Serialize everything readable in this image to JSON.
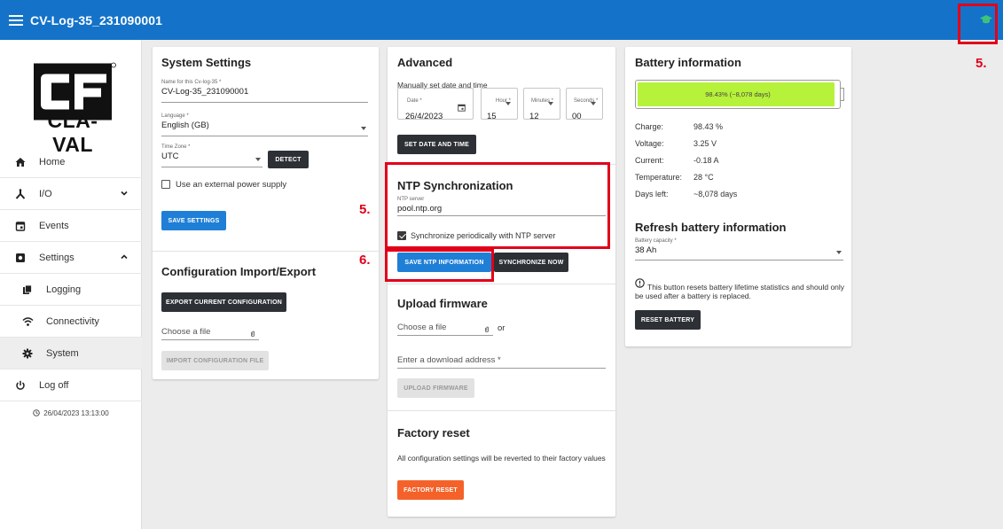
{
  "header": {
    "title": "CV-Log-35_231090001"
  },
  "sidebar": {
    "logo_text": "CLA-VAL",
    "items": [
      {
        "label": "Home",
        "icon": "home-icon"
      },
      {
        "label": "I/O",
        "icon": "io-icon"
      },
      {
        "label": "Events",
        "icon": "events-icon"
      },
      {
        "label": "Settings",
        "icon": "settings-icon"
      },
      {
        "label": "Logging",
        "icon": "logging-icon"
      },
      {
        "label": "Connectivity",
        "icon": "wifi-icon"
      },
      {
        "label": "System",
        "icon": "gear-icon"
      },
      {
        "label": "Log off",
        "icon": "power-icon"
      }
    ],
    "clock": "26/04/2023 13:13:00"
  },
  "system_settings": {
    "title": "System Settings",
    "name_label": "Name for this Cv-log-35 *",
    "name_value": "CV-Log-35_231090001",
    "language_label": "Language *",
    "language_value": "English (GB)",
    "timezone_label": "Time Zone *",
    "timezone_value": "UTC",
    "detect_label": "DETECT",
    "external_power_label": "Use an external power supply",
    "save_label": "SAVE SETTINGS",
    "config_title": "Configuration Import/Export",
    "export_label": "EXPORT CURRENT CONFIGURATION",
    "choose_file": "Choose a file",
    "import_label": "IMPORT CONFIGURATION FILE"
  },
  "advanced": {
    "title": "Advanced",
    "manual_label": "Manually set date and time",
    "date_label": "Date *",
    "date_value": "26/4/2023",
    "hour_label": "Hour *",
    "hour_value": "15",
    "minutes_label": "Minutes *",
    "minutes_value": "12",
    "seconds_label": "Seconds *",
    "seconds_value": "00",
    "set_label": "SET DATE AND TIME",
    "ntp_title": "NTP Synchronization",
    "ntp_server_label": "NTP server",
    "ntp_server_value": "pool.ntp.org",
    "sync_periodic_label": "Synchronize periodically with NTP server",
    "save_ntp_label": "SAVE NTP INFORMATION",
    "sync_now_label": "SYNCHRONIZE NOW",
    "upload_title": "Upload firmware",
    "choose_file": "Choose a file",
    "or_text": "or",
    "download_placeholder": "Enter a download address *",
    "upload_label": "UPLOAD FIRMWARE",
    "factory_title": "Factory reset",
    "factory_desc": "All configuration settings will be reverted to their factory values",
    "factory_label": "FACTORY RESET"
  },
  "battery": {
    "title": "Battery information",
    "bar_text": "98.43% (~8,078 days)",
    "level_fraction": 0.9843,
    "bar_color": "#b7f23a",
    "rows": [
      {
        "label": "Charge:",
        "value": "98.43 %"
      },
      {
        "label": "Voltage:",
        "value": "3.25 V"
      },
      {
        "label": "Current:",
        "value": "-0.18 A"
      },
      {
        "label": "Temperature:",
        "value": "28 °C"
      },
      {
        "label": "Days left:",
        "value": "~8,078 days"
      }
    ],
    "refresh_title": "Refresh battery information",
    "capacity_label": "Battery capacity *",
    "capacity_value": "38 Ah",
    "warning_text": "This button resets battery lifetime statistics and should only be used after a battery is replaced.",
    "reset_label": "RESET BATTERY"
  },
  "annotations": {
    "five": "5.",
    "six": "6."
  }
}
